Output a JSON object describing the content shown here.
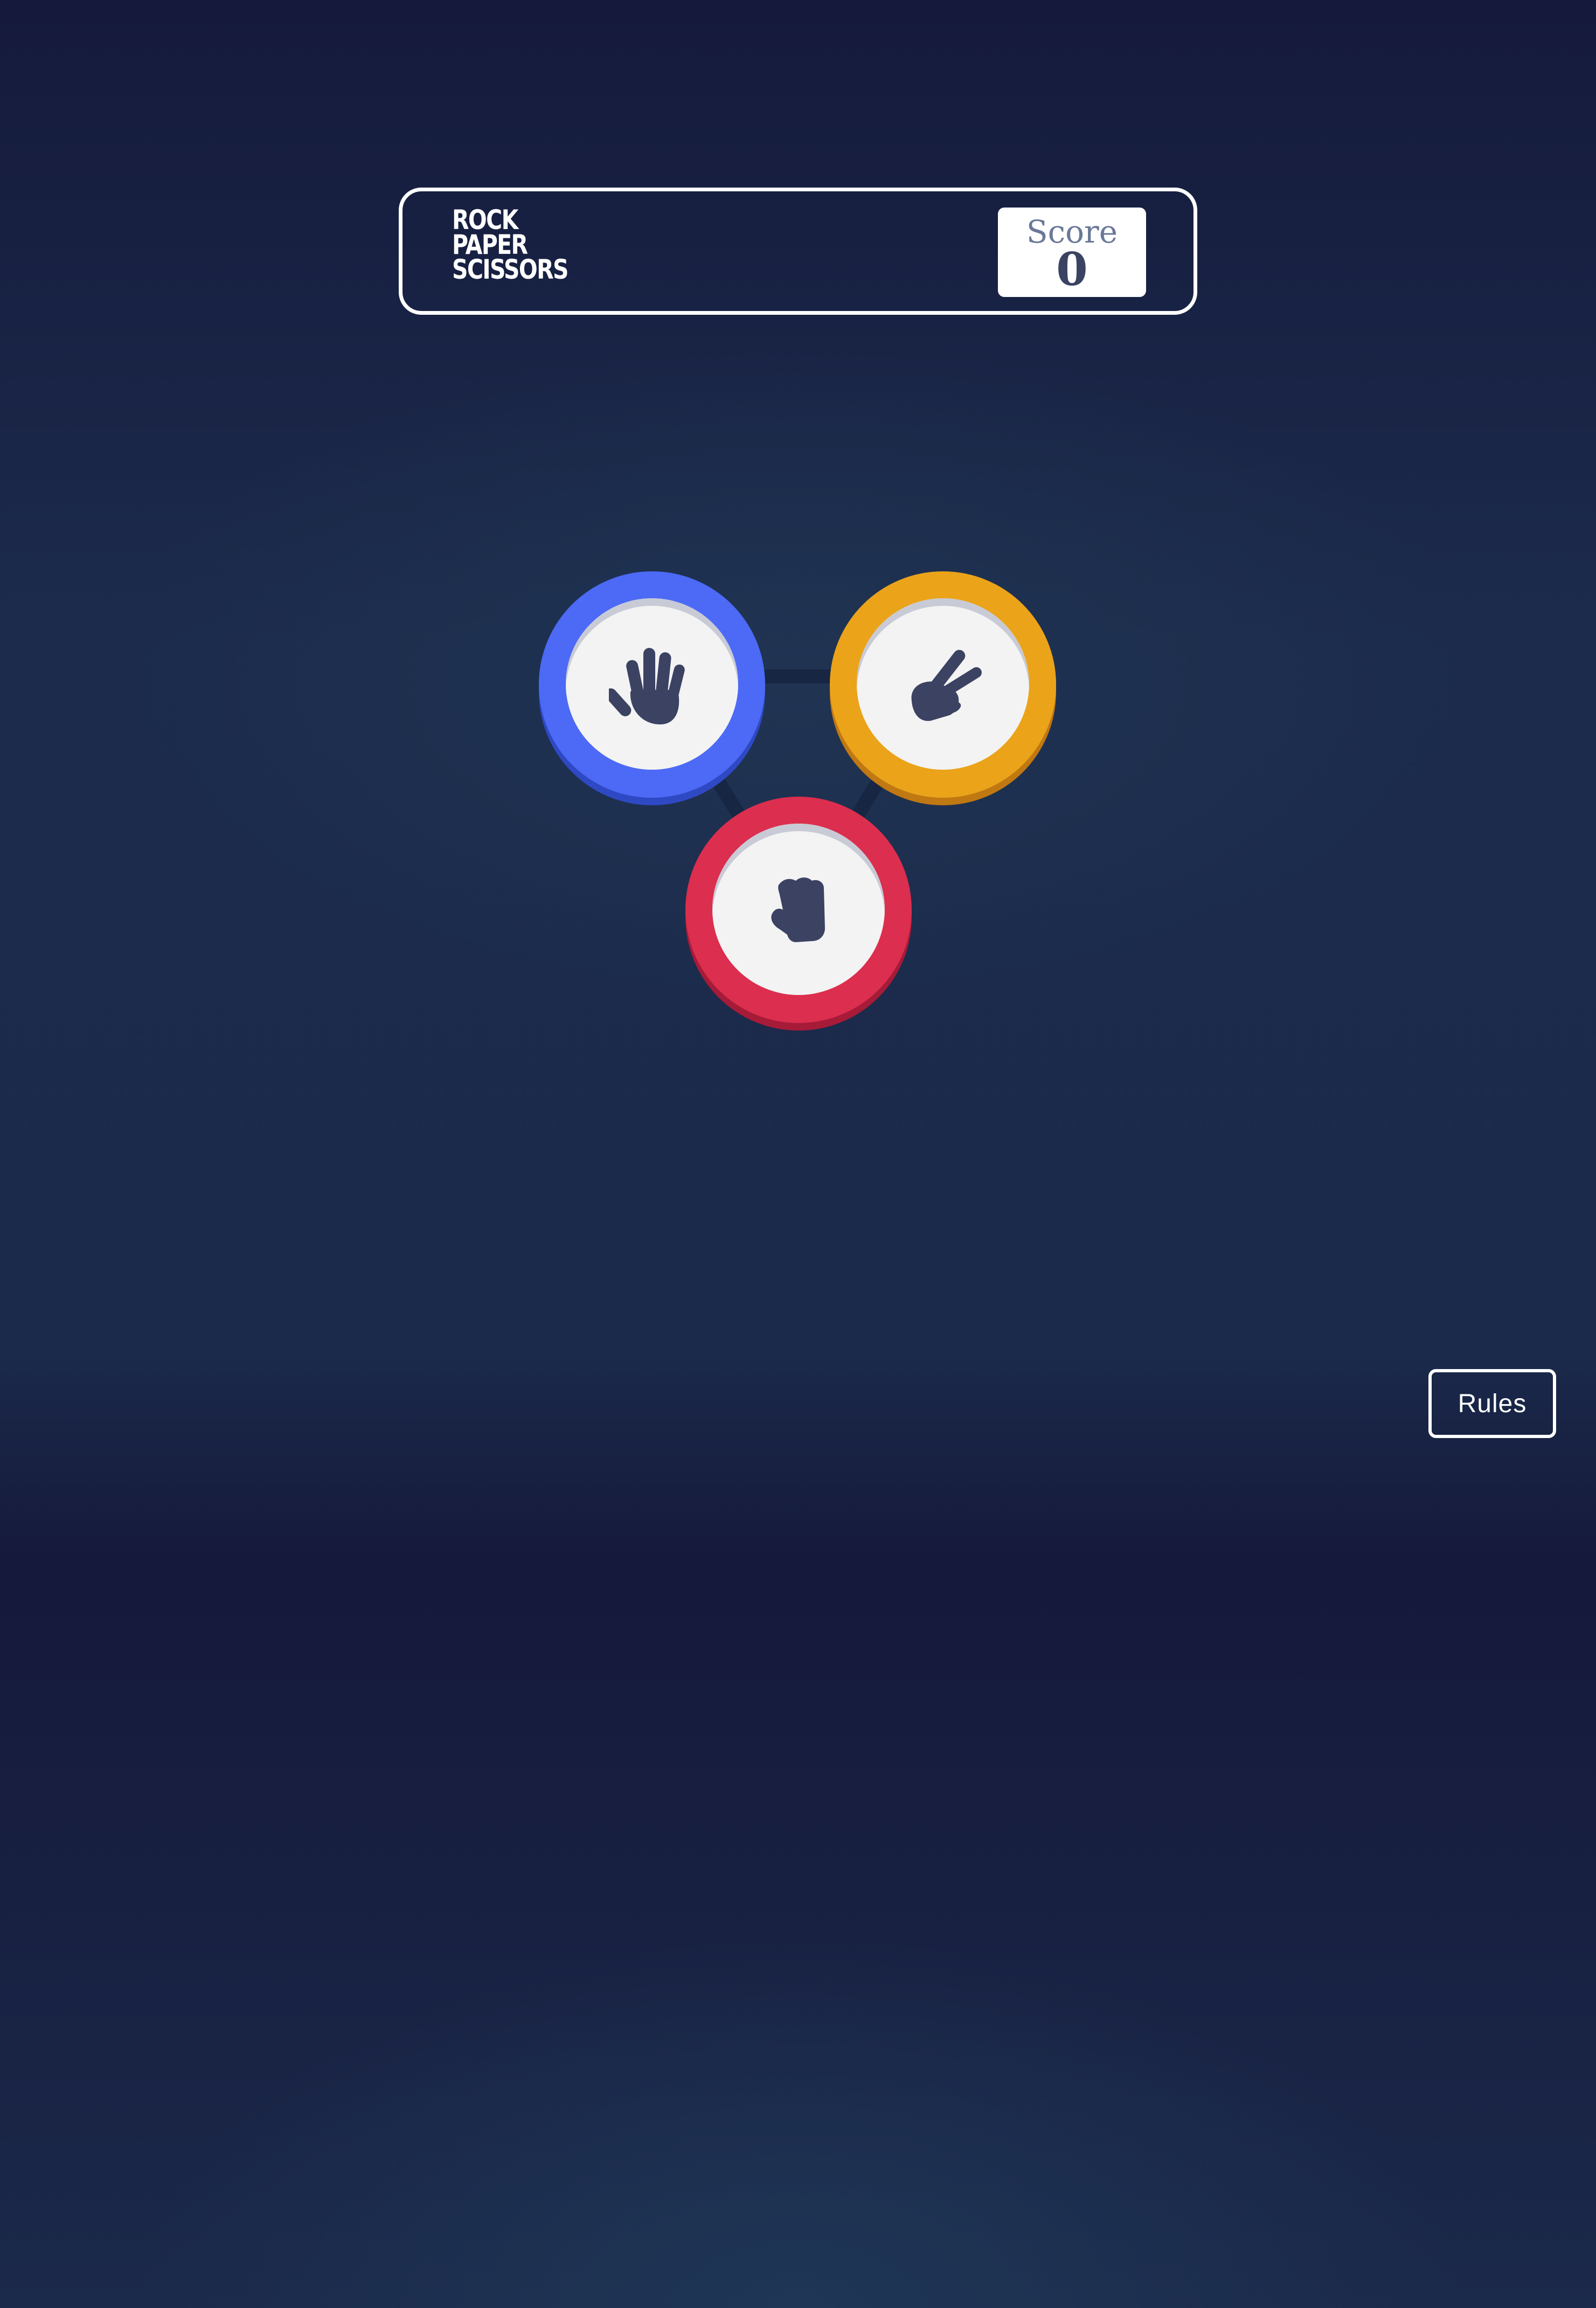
{
  "header": {
    "logo_lines": [
      "ROCK",
      "PAPER",
      "SCISSORS"
    ],
    "score_label": "Score",
    "score_value": "0"
  },
  "choices": [
    {
      "id": "paper",
      "icon": "hand-paper-icon",
      "color": "#4c6af5"
    },
    {
      "id": "scissors",
      "icon": "hand-scissors-icon",
      "color": "#eba31a"
    },
    {
      "id": "rock",
      "icon": "hand-rock-icon",
      "color": "#dc2e4e"
    }
  ],
  "rules_label": "Rules"
}
